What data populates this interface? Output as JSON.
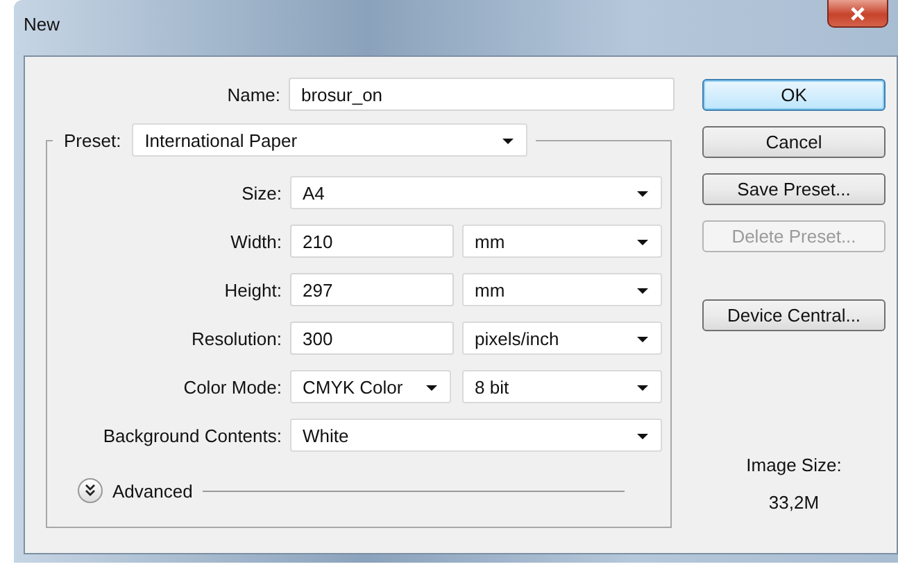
{
  "window": {
    "title": "New"
  },
  "name": {
    "label": "Name:",
    "value": "brosur_on"
  },
  "preset": {
    "label": "Preset:",
    "value": "International Paper"
  },
  "rows": [
    {
      "label": "Size:",
      "kind": "dropdown",
      "value": "A4"
    },
    {
      "label": "Width:",
      "kind": "number_unit",
      "value": "210",
      "unit": "mm"
    },
    {
      "label": "Height:",
      "kind": "number_unit",
      "value": "297",
      "unit": "mm"
    },
    {
      "label": "Resolution:",
      "kind": "number_unit",
      "value": "300",
      "unit": "pixels/inch"
    },
    {
      "label": "Color Mode:",
      "kind": "dropdown_pair",
      "value": "CMYK Color",
      "unit": "8 bit"
    },
    {
      "label": "Background Contents:",
      "kind": "dropdown",
      "value": "White"
    }
  ],
  "advanced": {
    "label": "Advanced",
    "expanded": false
  },
  "buttons": [
    {
      "label": "OK",
      "focused": true,
      "disabled": false
    },
    {
      "label": "Cancel",
      "focused": false,
      "disabled": false
    },
    {
      "label": "Save Preset...",
      "focused": false,
      "disabled": false
    },
    {
      "label": "Delete Preset...",
      "focused": false,
      "disabled": true
    },
    {
      "label": "Device Central...",
      "focused": false,
      "disabled": false
    }
  ],
  "image_size": {
    "label": "Image Size:",
    "value": "33,2M"
  }
}
